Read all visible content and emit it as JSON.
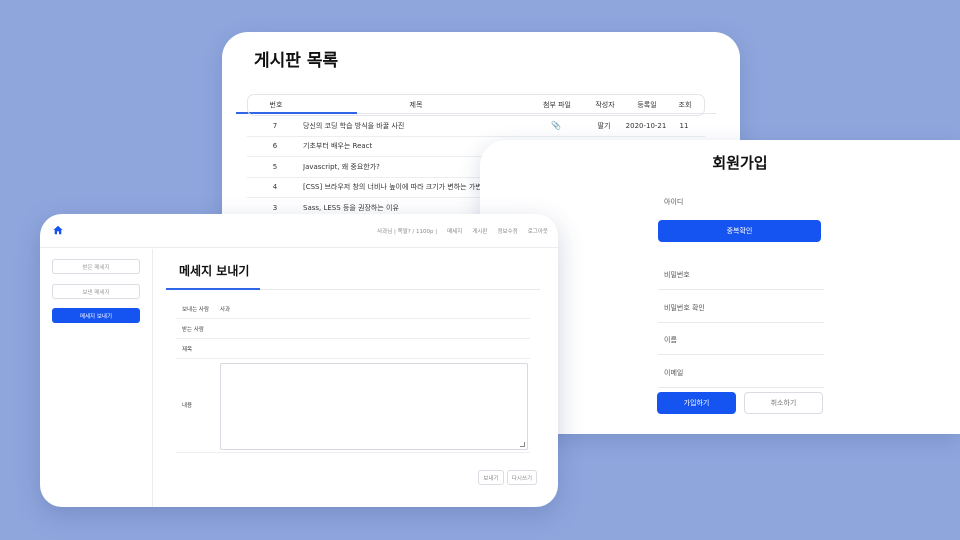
{
  "board": {
    "title": "게시판 목록",
    "columns": {
      "no": "번호",
      "title": "제목",
      "file": "첨부 파일",
      "writer": "작성자",
      "date": "등록일",
      "views": "조회"
    },
    "rows": [
      {
        "no": "7",
        "title": "당신의 코딩 학습 방식을 바꿀 사진",
        "file_icon": "paperclip-icon",
        "writer": "딸기",
        "date": "2020-10-21",
        "views": "11"
      },
      {
        "no": "6",
        "title": "기초부터 배우는 React"
      },
      {
        "no": "5",
        "title": "Javascript, 왜 중요한가?"
      },
      {
        "no": "4",
        "title": "[CSS] 브라우저 창의 너비나 높이에 따라 크기가 변하는 가변 폰"
      },
      {
        "no": "3",
        "title": "Sass, LESS 등을 권장하는 이유"
      }
    ]
  },
  "signup": {
    "title": "회원가입",
    "fields": {
      "id": "아이디",
      "password": "비밀번호",
      "password_confirm": "비밀번호 확인",
      "name": "이름",
      "email": "이메일"
    },
    "duplicate_check_label": "중복확인",
    "join_label": "가입하기",
    "cancel_label": "취소하기",
    "accent": "#1654f2"
  },
  "message": {
    "nav": [
      "사과님 | 쪽팔? / 1100p |",
      "메세지",
      "게시판",
      "정보수정",
      "로그아웃"
    ],
    "sidebar": {
      "received": "받은 메세지",
      "sent": "보낸 메세지",
      "send": "메세지 보내기"
    },
    "title": "메세지 보내기",
    "form": {
      "sender_label": "보내는 사람",
      "sender_value": "사과",
      "receiver_label": "받는 사람",
      "subject_label": "제목",
      "content_label": "내용"
    },
    "send_label": "보내기",
    "rewrite_label": "다시쓰기"
  }
}
